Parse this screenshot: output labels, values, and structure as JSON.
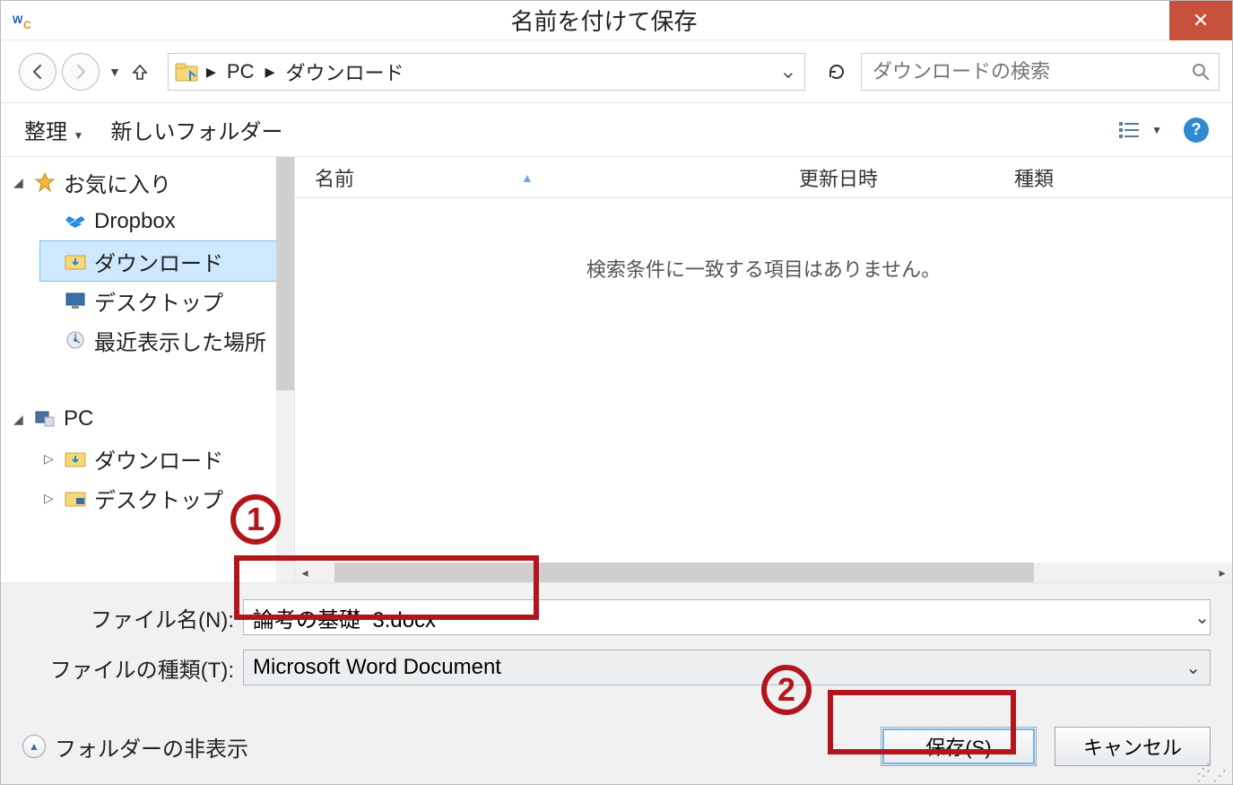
{
  "title": "名前を付けて保存",
  "nav": {
    "breadcrumb": [
      "PC",
      "ダウンロード"
    ],
    "search_placeholder": "ダウンロードの検索"
  },
  "toolbar": {
    "organize": "整理",
    "new_folder": "新しいフォルダー"
  },
  "tree": {
    "favorites": "お気に入り",
    "dropbox": "Dropbox",
    "downloads": "ダウンロード",
    "desktop": "デスクトップ",
    "recent": "最近表示した場所",
    "pc": "PC",
    "pc_downloads": "ダウンロード",
    "pc_desktop": "デスクトップ"
  },
  "columns": {
    "name": "名前",
    "date": "更新日時",
    "type": "種類"
  },
  "empty_msg": "検索条件に一致する項目はありません。",
  "form": {
    "filename_label": "ファイル名(N):",
    "filename_value": "論考の基礎_3.docx",
    "filetype_label": "ファイルの種類(T):",
    "filetype_value": "Microsoft Word Document"
  },
  "footer": {
    "hide_folders": "フォルダーの非表示",
    "save": "保存(S)",
    "cancel": "キャンセル"
  },
  "annotations": {
    "one": "1",
    "two": "2"
  }
}
